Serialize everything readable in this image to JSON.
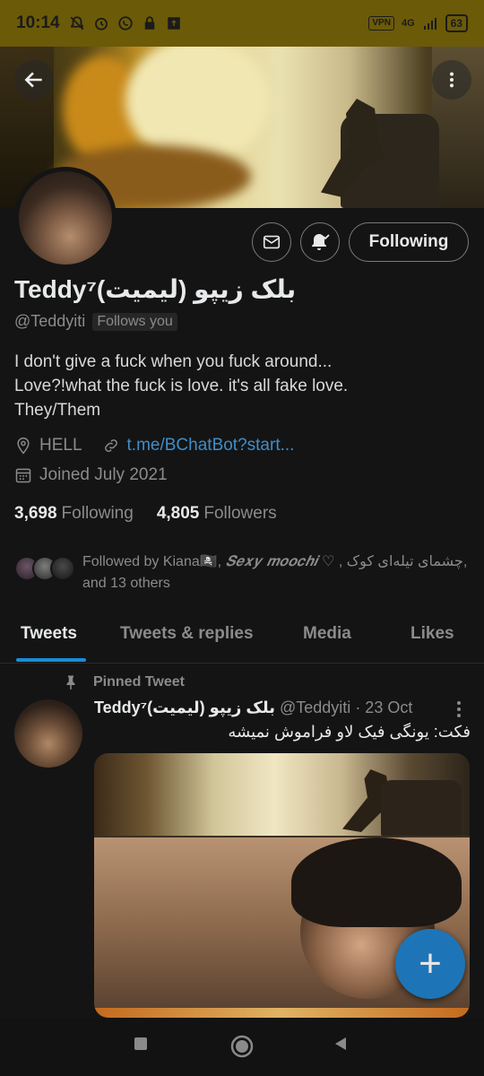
{
  "status_bar": {
    "time": "10:14",
    "vpn": "VPN",
    "network": "4G",
    "battery": "63"
  },
  "profile": {
    "name": "Teddy⁷(بلک زیپو (لیمیت",
    "handle": "@Teddyiti",
    "follows_you": "Follows you",
    "bio": [
      "I don't give a fuck when you fuck around...",
      "Love?!what the fuck is love. it's all fake love.",
      "They/Them"
    ],
    "location": "HELL",
    "link": "t.me/BChatBot?start...",
    "joined": "Joined July 2021",
    "following_count": "3,698",
    "following_label": "Following",
    "followers_count": "4,805",
    "followers_label": "Followers",
    "followed_by_prefix": "Followed by Kiana🏴‍☠️, ",
    "followed_by_name2": "𝑺𝒆𝒙𝒚 𝒎𝒐𝒐𝒄𝒉𝒊 ♡",
    "followed_by_name3": ", چشمای تیله‌ای کوک,",
    "followed_by_suffix": "and 13 others"
  },
  "actions": {
    "following_button": "Following"
  },
  "tabs": [
    "Tweets",
    "Tweets & replies",
    "Media",
    "Likes"
  ],
  "pinned_tweet": {
    "label": "Pinned Tweet",
    "author_name": "Teddy⁷(بلک زیپو (لیمیت",
    "author_handle": "@Teddyiti",
    "date": "· 23 Oct",
    "text": "فکت: یونگی فیک لاو فراموش نمیشه"
  },
  "fab": {
    "label": "+"
  },
  "colors": {
    "accent": "#1a8cd8",
    "link": "#3d8ecb",
    "status_bar": "#6b5a08",
    "background": "#141414"
  }
}
